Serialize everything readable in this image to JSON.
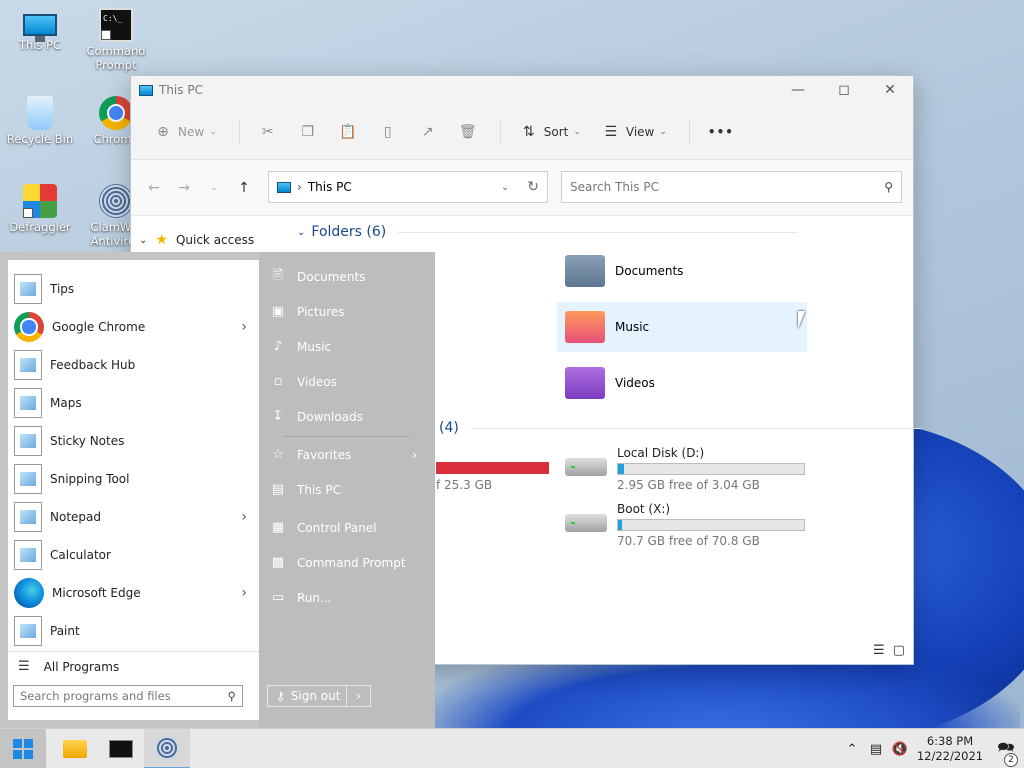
{
  "desktop": {
    "icons": [
      {
        "label": "This PC"
      },
      {
        "label": "Command Prompt"
      },
      {
        "label": "Recycle Bin"
      },
      {
        "label": "Chrome"
      },
      {
        "label": "Defraggler"
      },
      {
        "label": "ClamWin Antivirus"
      }
    ]
  },
  "explorer": {
    "title": "This PC",
    "toolbar": {
      "new_label": "New",
      "sort_label": "Sort",
      "view_label": "View",
      "more_label": "•••"
    },
    "address": {
      "location": "This PC"
    },
    "search": {
      "placeholder": "Search This PC"
    },
    "nav_pane": {
      "quick_access": "Quick access"
    },
    "folders_heading": "Folders (6)",
    "folders": [
      {
        "name": "Documents"
      },
      {
        "name": "Music"
      },
      {
        "name": "Videos"
      }
    ],
    "drives_heading_count": "(4)",
    "partial_drive_free": "f 25.3 GB",
    "drives": [
      {
        "name": "Local Disk (D:)",
        "free": "2.95 GB free of 3.04 GB",
        "used_fraction": 0.03
      },
      {
        "name": "Boot (X:)",
        "free": "70.7 GB free of 70.8 GB",
        "used_fraction": 0.001
      }
    ]
  },
  "start_menu": {
    "apps": [
      {
        "label": "Tips",
        "arrow": ""
      },
      {
        "label": "Google Chrome",
        "arrow": "›"
      },
      {
        "label": "Feedback Hub",
        "arrow": ""
      },
      {
        "label": "Maps",
        "arrow": ""
      },
      {
        "label": "Sticky Notes",
        "arrow": ""
      },
      {
        "label": "Snipping Tool",
        "arrow": ""
      },
      {
        "label": "Notepad",
        "arrow": "›"
      },
      {
        "label": "Calculator",
        "arrow": ""
      },
      {
        "label": "Microsoft Edge",
        "arrow": "›"
      },
      {
        "label": "Paint",
        "arrow": ""
      }
    ],
    "all_programs": "All Programs",
    "search_placeholder": "Search programs and files",
    "places": [
      {
        "label": "Documents"
      },
      {
        "label": "Pictures"
      },
      {
        "label": "Music"
      },
      {
        "label": "Videos"
      },
      {
        "label": "Downloads"
      },
      {
        "label": "Favorites"
      },
      {
        "label": "This PC"
      },
      {
        "label": "Control Panel"
      },
      {
        "label": "Command Prompt"
      },
      {
        "label": "Run..."
      }
    ],
    "sign_out": "Sign out"
  },
  "taskbar": {
    "time": "6:38 PM",
    "date": "12/22/2021",
    "notification_count": "2"
  }
}
